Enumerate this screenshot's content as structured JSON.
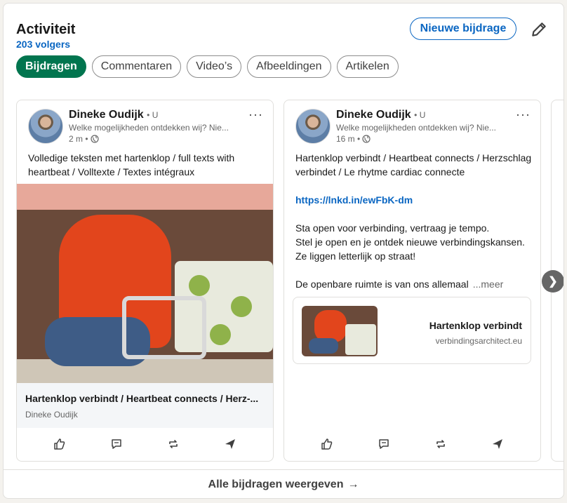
{
  "header": {
    "title": "Activiteit",
    "followers": "203 volgers",
    "new_post_label": "Nieuwe bijdrage"
  },
  "tabs": [
    {
      "label": "Bijdragen",
      "active": true
    },
    {
      "label": "Commentaren",
      "active": false
    },
    {
      "label": "Video’s",
      "active": false
    },
    {
      "label": "Afbeeldingen",
      "active": false
    },
    {
      "label": "Artikelen",
      "active": false
    }
  ],
  "posts": [
    {
      "author": "Dineke Oudijk",
      "degree": "• U",
      "headline": "Welke mogelijkheden ontdekken wij? Nie...",
      "time": "2 m •",
      "more_label": "···",
      "text": "Volledige teksten met hartenklop / full texts with heartbeat / Volltexte / Textes intégraux",
      "link_title": "Hartenklop verbindt / Heartbeat connects / Herz-...",
      "link_author": "Dineke Oudijk"
    },
    {
      "author": "Dineke Oudijk",
      "degree": "• U",
      "headline": "Welke mogelijkheden ontdekken wij? Nie...",
      "time": "16 m •",
      "more_label": "···",
      "lines": [
        "Hartenklop verbindt / Heartbeat connects / Herzschlag verbindet / Le rhytme cardiac connecte",
        "",
        "https://lnkd.in/ewFbK-dm",
        "",
        "Sta open voor verbinding, vertraag je tempo.",
        "Stel je open en je ontdek nieuwe verbindingskansen.",
        "Ze liggen letterlijk op straat!",
        "",
        "De openbare ruimte is van ons allemaal"
      ],
      "more_text": "...meer",
      "preview_title": "Hartenklop verbindt",
      "preview_domain": "verbindingsarchitect.eu"
    }
  ],
  "next_arrow": "❯",
  "footer": {
    "label": "Alle bijdragen weergeven",
    "arrow": "→"
  },
  "colors": {
    "accent": "#0a66c2",
    "active_tab": "#01754f"
  }
}
